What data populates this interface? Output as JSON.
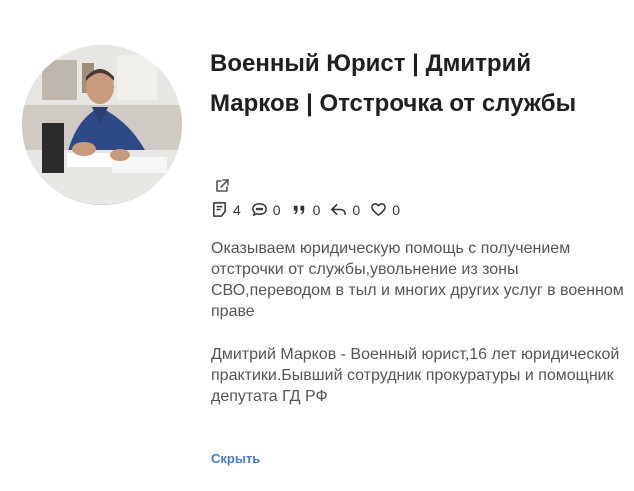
{
  "profile": {
    "title": "Военный Юрист | Дмитрий Марков | Отстрочка от службы",
    "avatar_alt": "profile-photo"
  },
  "stats": {
    "posts": "4",
    "comments": "0",
    "quotes": "0",
    "reposts": "0",
    "likes": "0"
  },
  "description": {
    "paragraph1": "Оказываем юридическую помощь с получением отстрочки от службы,увольнение из зоны СВО,переводом в тыл и многих других услуг в военном праве",
    "paragraph2": "Дмитрий Марков - Военный юрист,16 лет юридической практики.Бывший сотрудник прокуратуры и помощник депутата ГД РФ"
  },
  "actions": {
    "hide_label": "Скрыть"
  },
  "colors": {
    "link": "#4a7cc3",
    "text_muted": "#555555",
    "title": "#1f1f1f"
  }
}
